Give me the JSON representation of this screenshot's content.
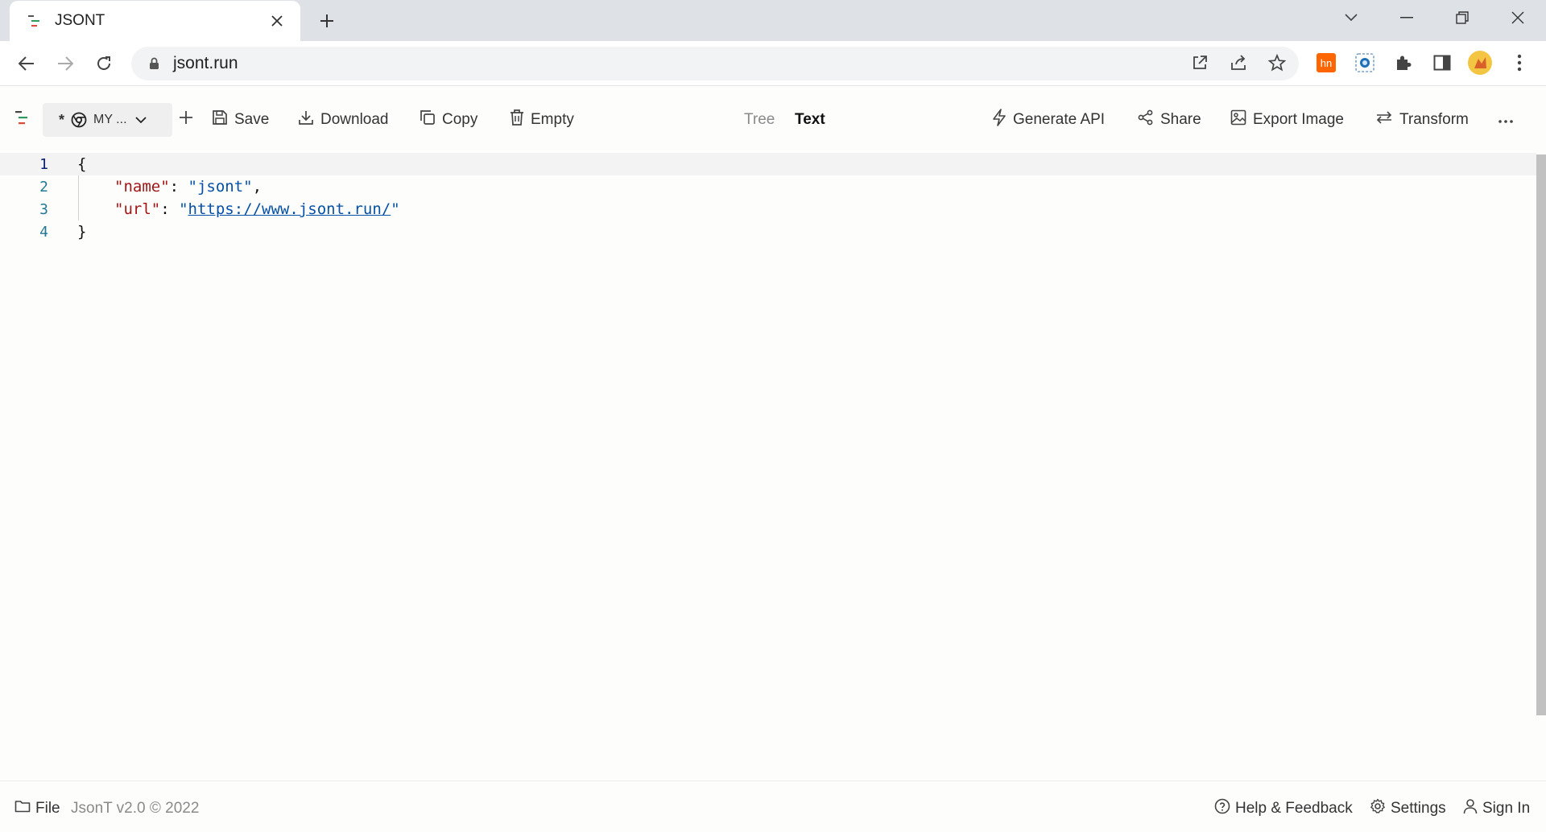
{
  "browser": {
    "tab_title": "JSONT",
    "url": "jsont.run",
    "extensions": [
      "hn-extension-icon",
      "screen-capture-extension-icon",
      "puzzle-icon",
      "sidepanel-icon",
      "profile-avatar"
    ]
  },
  "toolbar": {
    "doc_name": "MY ...",
    "doc_prefix": "*",
    "save_label": "Save",
    "download_label": "Download",
    "copy_label": "Copy",
    "empty_label": "Empty",
    "tree_label": "Tree",
    "text_label": "Text",
    "active_view": "Text",
    "generate_api_label": "Generate API",
    "share_label": "Share",
    "export_image_label": "Export Image",
    "transform_label": "Transform",
    "more_label": "···"
  },
  "editor": {
    "line_numbers": [
      "1",
      "2",
      "3",
      "4"
    ],
    "open_brace": "{",
    "close_brace": "}",
    "name_key": "\"name\"",
    "name_value": "\"jsont\"",
    "url_key": "\"url\"",
    "url_value_open_quote": "\"",
    "url_value_link": "https://www.jsont.run/",
    "url_value_close_quote": "\"",
    "colon": ": ",
    "comma": ","
  },
  "footer": {
    "file_label": "File",
    "version": "JsonT v2.0 © 2022",
    "help_label": "Help & Feedback",
    "settings_label": "Settings",
    "signin_label": "Sign In"
  },
  "colors": {
    "json_key": "#a31515",
    "json_string": "#0451a5",
    "line_number": "#237893",
    "accent_logo_green": "#2e9b5e",
    "accent_logo_red": "#d94a3a",
    "hn_orange": "#ff6600"
  }
}
